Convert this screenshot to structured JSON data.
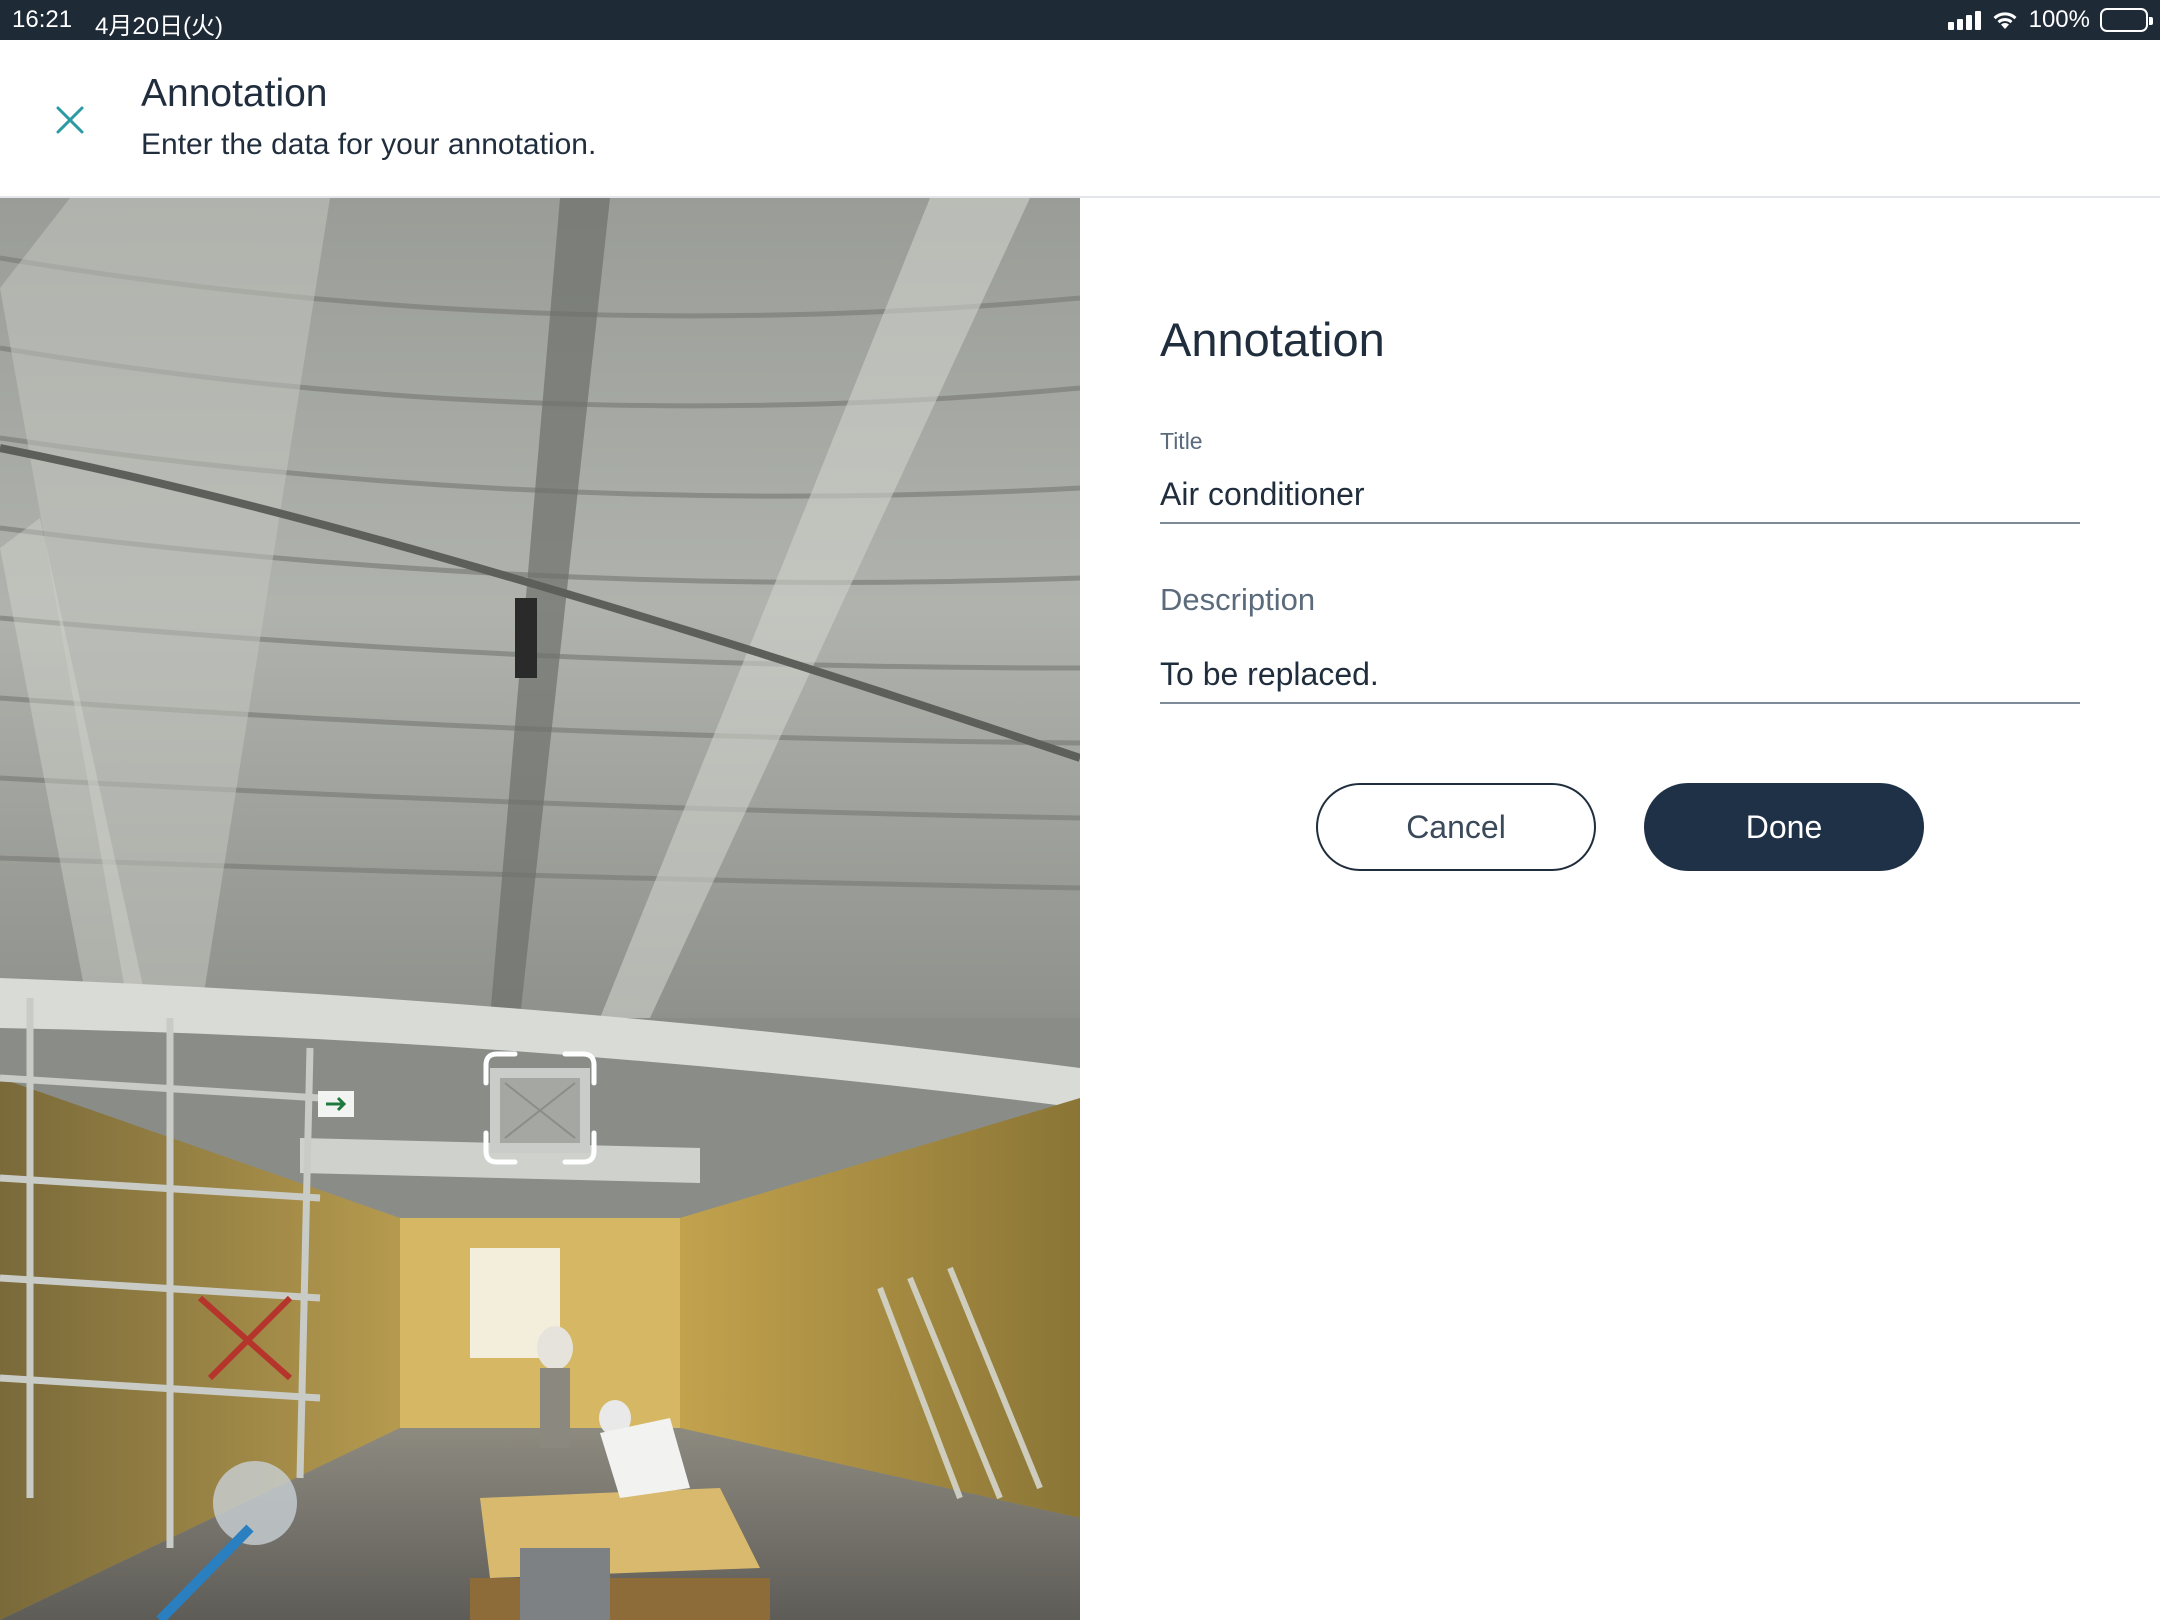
{
  "status_bar": {
    "time": "16:21",
    "date": "4月20日(火)",
    "battery": "100%",
    "icons": [
      "signal-icon",
      "wifi-icon",
      "battery-icon"
    ]
  },
  "header": {
    "title": "Annotation",
    "subtitle": "Enter the data for your annotation.",
    "close_icon": "close-icon"
  },
  "panorama": {
    "target_icon": "focus-frame-icon"
  },
  "form": {
    "heading": "Annotation",
    "title_label": "Title",
    "title_value": "Air conditioner",
    "description_label": "Description",
    "description_value": "To be replaced.",
    "cancel_label": "Cancel",
    "done_label": "Done"
  },
  "colors": {
    "status_bar_bg": "#1f2a37",
    "accent_teal": "#2a9aa5",
    "primary_button": "#1f3147",
    "text_dark": "#1f2d3d"
  }
}
